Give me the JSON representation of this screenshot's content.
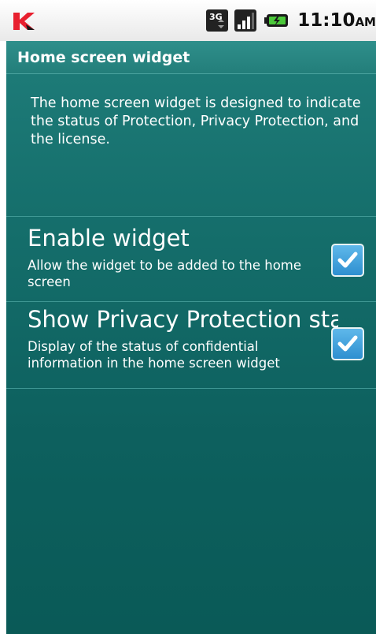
{
  "status_bar": {
    "network_type": "3G",
    "signal_icon": "signal-bars-icon",
    "battery_icon": "battery-charging-icon",
    "time": "11:10",
    "ampm": "AM",
    "app_icon": "kaspersky-k-icon"
  },
  "header": {
    "title": "Home screen widget"
  },
  "description": "The home screen widget is designed to indicate the status of Protection, Privacy Protection, and the license.",
  "preferences": [
    {
      "title": "Enable widget",
      "summary": "Allow the widget to be added to the home screen",
      "checked": true
    },
    {
      "title": "Show Privacy Protection status",
      "summary": "Display of the status of confidential information in the home screen widget",
      "checked": true
    }
  ],
  "colors": {
    "background": "#16706d",
    "title_bar": "#237e7a",
    "checkbox": "#2e8fd0",
    "text": "#ffffff"
  }
}
